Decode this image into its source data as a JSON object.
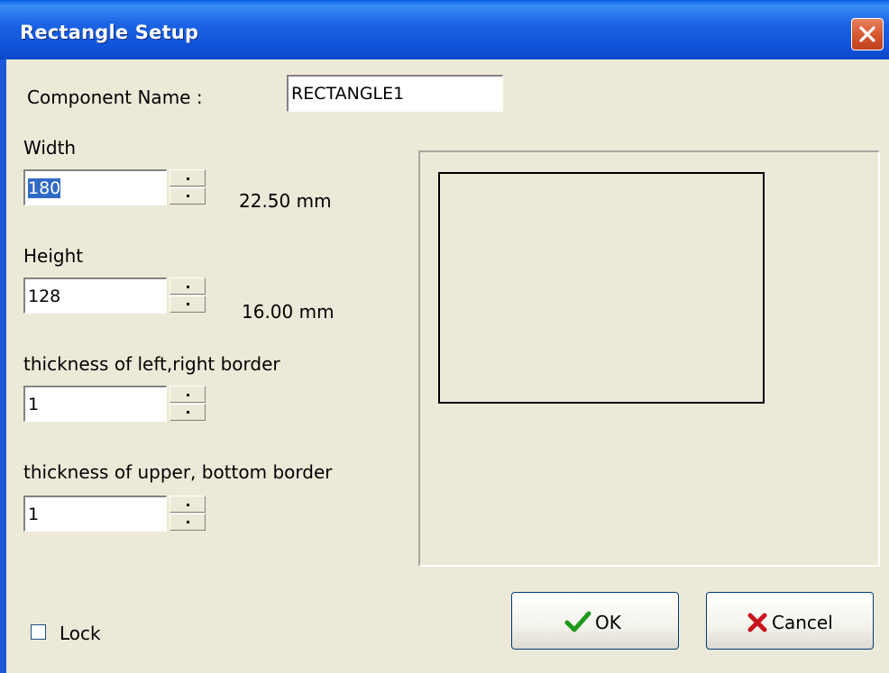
{
  "window": {
    "title": "Rectangle Setup"
  },
  "component_name": {
    "label": "Component Name :",
    "value": "RECTANGLE1"
  },
  "width": {
    "label": "Width",
    "value": "180",
    "mm": "22.50 mm"
  },
  "height": {
    "label": "Height",
    "value": "128",
    "mm": "16.00 mm"
  },
  "lr_border": {
    "label": "thickness of left,right border",
    "value": "1"
  },
  "ub_border": {
    "label": "thickness of upper, bottom border",
    "value": "1"
  },
  "lock": {
    "label": "Lock",
    "checked": false
  },
  "buttons": {
    "ok": "OK",
    "cancel": "Cancel"
  },
  "colors": {
    "titlebar": "#0a49c8",
    "dialog_bg": "#ece9d8",
    "selection": "#316ac5",
    "ok_check": "#1e9a1e",
    "cancel_x": "#c8141e"
  },
  "icons": {
    "close": "close-icon",
    "ok": "checkmark-icon",
    "cancel": "x-icon"
  }
}
